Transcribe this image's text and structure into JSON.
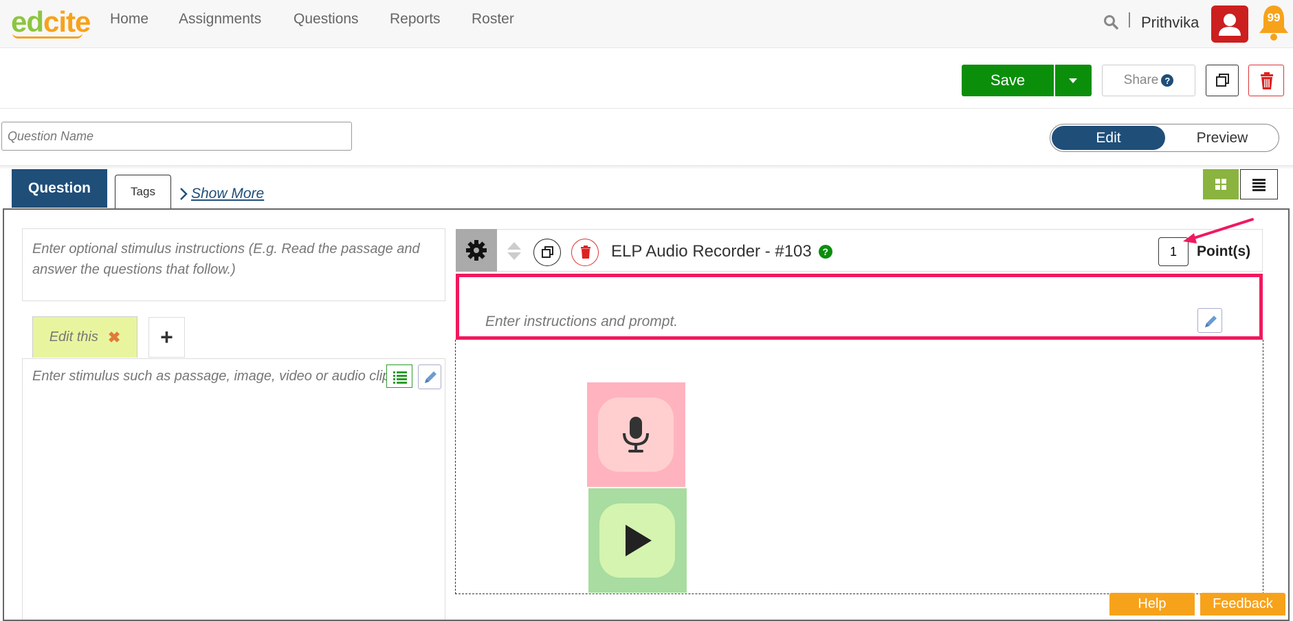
{
  "app": {
    "logo_part1": "ed",
    "logo_part2": "cite"
  },
  "nav": {
    "items": [
      "Home",
      "Assignments",
      "Questions",
      "Reports",
      "Roster"
    ],
    "user_name": "Prithvika",
    "notification_count": "99"
  },
  "toolbar": {
    "save_label": "Save",
    "share_label": "Share",
    "share_help": "?"
  },
  "editor": {
    "question_name_placeholder": "Question Name",
    "mode_edit": "Edit",
    "mode_preview": "Preview"
  },
  "tabs": {
    "question": "Question",
    "tags": "Tags",
    "show_more": "Show More"
  },
  "stimulus": {
    "instructions_placeholder": "Enter optional stimulus instructions (E.g. Read the passage and answer the questions that follow.)",
    "tab_label": "Edit this",
    "tab_close": "✖",
    "add_tab": "+",
    "body_placeholder": "Enter stimulus such as passage, image, video or audio clip"
  },
  "question": {
    "title": "ELP Audio Recorder - #103",
    "help": "?",
    "points_value": "1",
    "points_label": "Point(s)",
    "prompt_placeholder": "Enter instructions and prompt."
  },
  "footer": {
    "help": "Help",
    "feedback": "Feedback"
  },
  "colors": {
    "brand_navy": "#1f4e79",
    "save_green": "#0b8f0b",
    "highlight_pink": "#f0195e",
    "accent_orange": "#f7a21b"
  }
}
